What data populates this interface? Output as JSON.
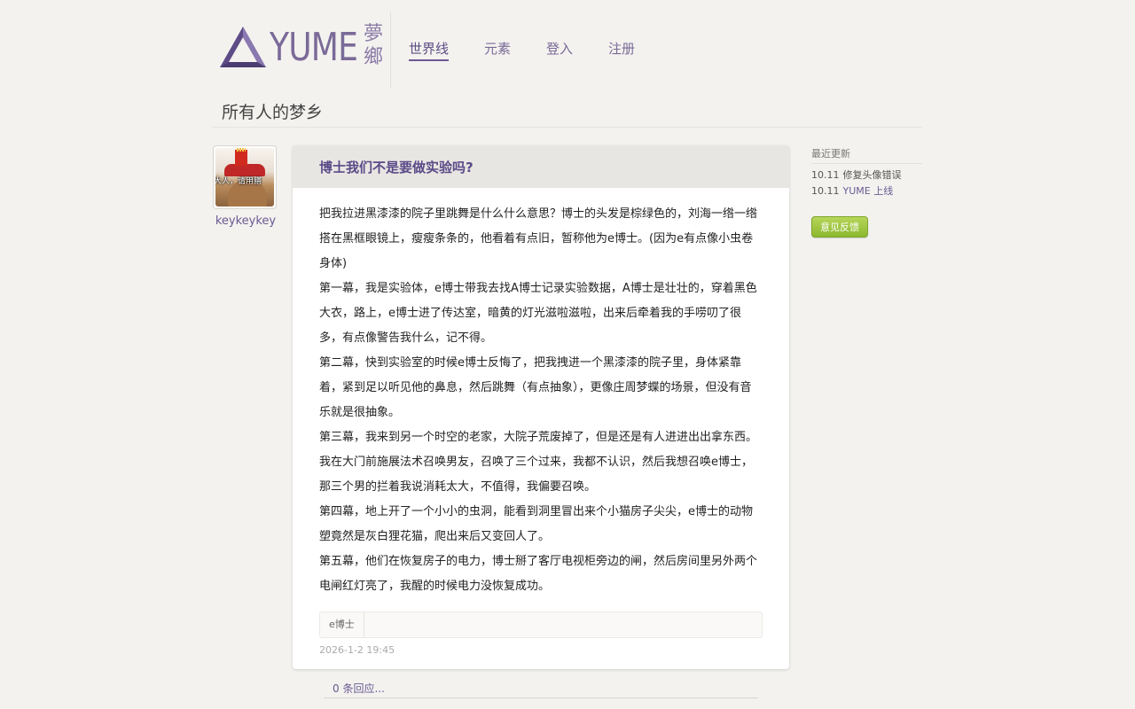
{
  "brand": {
    "logo_text": "YUME",
    "logo_cn_top": "夢",
    "logo_cn_bottom": "鄉"
  },
  "nav": [
    {
      "label": "世界线",
      "active": true
    },
    {
      "label": "元素"
    },
    {
      "label": "登入"
    },
    {
      "label": "注册"
    }
  ],
  "page_title": "所有人的梦乡",
  "author": {
    "name": "keykeykey",
    "avatar_caption": "大人，请用膳"
  },
  "post": {
    "title": "博士我们不是要做实验吗?",
    "paragraphs": [
      "把我拉进黑漆漆的院子里跳舞是什么什么意思？博士的头发是棕绿色的，刘海一绺一绺搭在黑框眼镜上，瘦瘦条条的，他看着有点旧，暂称他为e博士。(因为e有点像小虫卷身体)",
      "第一幕，我是实验体，e博士带我去找A博士记录实验数据，A博士是壮壮的，穿着黑色大衣，路上，e博士进了传达室，暗黄的灯光滋啦滋啦，出来后牵着我的手唠叨了很多，有点像警告我什么，记不得。",
      "第二幕，快到实验室的时候e博士反悔了，把我拽进一个黑漆漆的院子里，身体紧靠着，紧到足以听见他的鼻息，然后跳舞（有点抽象），更像庄周梦蝶的场景，但没有音乐就是很抽象。",
      "第三幕，我来到另一个时空的老家，大院子荒废掉了，但是还是有人进进出出拿东西。我在大门前施展法术召唤男友，召唤了三个过来，我都不认识，然后我想召唤e博士，那三个男的拦着我说消耗太大，不值得，我偏要召唤。",
      "第四幕，地上开了一个小小的虫洞，能看到洞里冒出来个小猫房子尖尖，e博士的动物塑竟然是灰白狸花猫，爬出来后又变回人了。",
      "第五幕，他们在恢复房子的电力，博士掰了客厅电视柜旁边的闸，然后房间里另外两个电闸红灯亮了，我醒的时候电力没恢复成功。"
    ],
    "tags": [
      "e博士"
    ],
    "date": "2026-1-2 19:45",
    "replies_label": "0 条回应..."
  },
  "sidebar": {
    "recent_title": "最近更新",
    "updates": [
      {
        "date": "10.11",
        "text": "修复头像错误"
      },
      {
        "date": "10.11",
        "text": "YUME 上线"
      }
    ],
    "feedback_label": "意见反馈"
  },
  "colors": {
    "accent": "#6a5a92",
    "feedback": "#8cb82e",
    "background": "#f3f2ef"
  }
}
